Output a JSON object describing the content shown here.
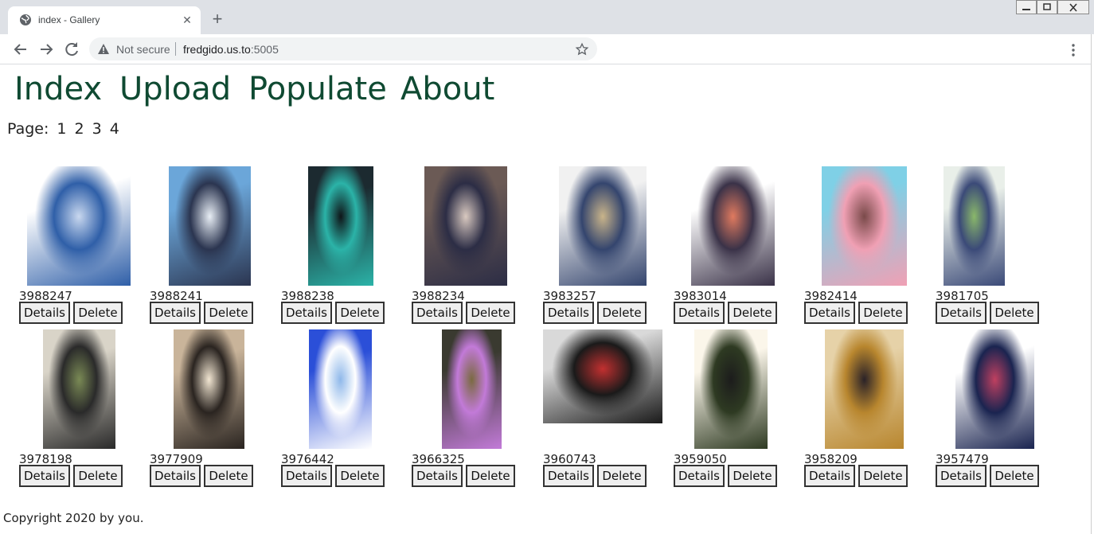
{
  "browser": {
    "tab_title": "index - Gallery",
    "security_label": "Not secure",
    "url_host": "fredgido.us.to",
    "url_port": ":5005"
  },
  "nav": [
    "Index",
    "Upload",
    "Populate",
    "About"
  ],
  "pager": {
    "label": "Page:",
    "pages": [
      "1",
      "2",
      "3",
      "4"
    ]
  },
  "gallery": {
    "details_label": "Details",
    "delete_label": "Delete",
    "items": [
      {
        "id": "3988247",
        "colors": [
          "#ffffff",
          "#2f5fa8",
          "#c9d8ef"
        ]
      },
      {
        "id": "3988241",
        "colors": [
          "#6ba6d9",
          "#2b3550",
          "#e8eef5"
        ]
      },
      {
        "id": "3988238",
        "colors": [
          "#1c2a30",
          "#2bb3a8",
          "#0f1518"
        ]
      },
      {
        "id": "3988234",
        "colors": [
          "#6b5a55",
          "#2c2d45",
          "#d9c9c0"
        ]
      },
      {
        "id": "3983257",
        "colors": [
          "#f1f1f1",
          "#34456e",
          "#c9b48a"
        ]
      },
      {
        "id": "3983014",
        "colors": [
          "#ffffff",
          "#3a3248",
          "#e07a5f"
        ]
      },
      {
        "id": "3982414",
        "colors": [
          "#7fd0e6",
          "#f0a0b4",
          "#7a4a4a"
        ]
      },
      {
        "id": "3981705",
        "colors": [
          "#e9efe9",
          "#3b4a78",
          "#8ab86a"
        ]
      },
      {
        "id": "3978198",
        "colors": [
          "#d9d4c8",
          "#2a2a2a",
          "#7a8a55"
        ]
      },
      {
        "id": "3977909",
        "colors": [
          "#c9b49a",
          "#2a2420",
          "#f2e6d2"
        ]
      },
      {
        "id": "3976442",
        "colors": [
          "#2b4fd8",
          "#ffffff",
          "#8fb8ea"
        ]
      },
      {
        "id": "3966325",
        "colors": [
          "#3a3a30",
          "#c27ad8",
          "#7a6a40"
        ]
      },
      {
        "id": "3960743",
        "colors": [
          "#d9d9d9",
          "#1a1a1a",
          "#c23030"
        ]
      },
      {
        "id": "3959050",
        "colors": [
          "#fbf6ea",
          "#2e3a22",
          "#1c1c1c"
        ]
      },
      {
        "id": "3958209",
        "colors": [
          "#e6d2a8",
          "#b8862e",
          "#2a2228"
        ]
      },
      {
        "id": "3957479",
        "colors": [
          "#ffffff",
          "#1a2450",
          "#c04060"
        ]
      }
    ]
  },
  "footer": "Copyright 2020 by you."
}
